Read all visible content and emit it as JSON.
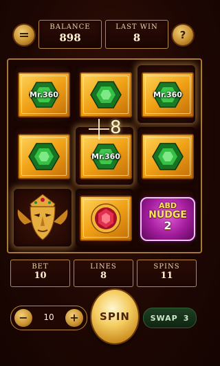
{
  "header": {
    "menu_icon": "menu-icon",
    "help_label": "?",
    "balance": {
      "label": "BALANCE",
      "value": "898"
    },
    "last_win": {
      "label": "LAST WIN",
      "value": "8"
    }
  },
  "reels": {
    "symbols": [
      [
        "Mr.360",
        "green-gem",
        "Mr.360"
      ],
      [
        "green-gem",
        "Mr.360",
        "green-gem"
      ],
      [
        "golden-mask",
        "red-gem",
        "ABD NUDGE 2"
      ]
    ],
    "mr_label": "Mr.360",
    "nudge": {
      "line1": "ABD",
      "line2": "NUDGE",
      "line3": "2"
    },
    "crosshair_number": "8"
  },
  "footer": {
    "bet": {
      "label": "BET",
      "value": "10"
    },
    "lines": {
      "label": "LINES",
      "value": "8"
    },
    "spins": {
      "label": "SPINS",
      "value": "11"
    },
    "stepper": {
      "minus": "−",
      "plus": "+",
      "value": "10"
    },
    "spin_label": "SPIN",
    "swap": {
      "label": "SWAP",
      "count": "3"
    }
  },
  "colors": {
    "gold": "#f0a116",
    "emerald": "#2fae3a",
    "ruby": "#d3163a",
    "nudge_purple": "#a41d9e"
  }
}
